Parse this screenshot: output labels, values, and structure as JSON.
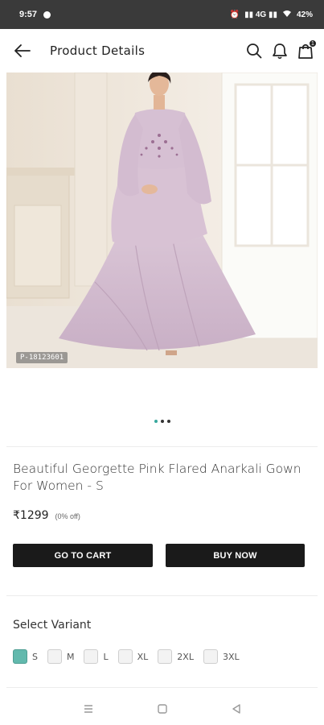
{
  "status_bar": {
    "time": "9:57",
    "battery": "42%",
    "indicators": "⚠ ⅈ Vo 4G LTE2 ⁴ᴳ .ıl"
  },
  "header": {
    "title": "Product Details",
    "cart_count": "1",
    "icons": [
      "back-arrow-icon",
      "search-icon",
      "bell-icon",
      "shopping-bag-icon"
    ]
  },
  "product": {
    "image_id_tag": "P-18123601",
    "title": "Beautiful Georgette Pink Flared Anarkali Gown For Women - S",
    "price": "₹1299",
    "discount": "(0% off)",
    "carousel": {
      "count": 3,
      "active_index": 0
    }
  },
  "actions": {
    "go_to_cart": "GO TO CART",
    "buy_now": "BUY NOW"
  },
  "variants": {
    "label": "Select Variant",
    "selected": "S",
    "options": [
      "S",
      "M",
      "L",
      "XL",
      "2XL",
      "3XL"
    ]
  },
  "colors": {
    "accent": "#62b9ad",
    "button_bg": "#1a1a1a",
    "status_bar_bg": "#3a3a3a"
  }
}
